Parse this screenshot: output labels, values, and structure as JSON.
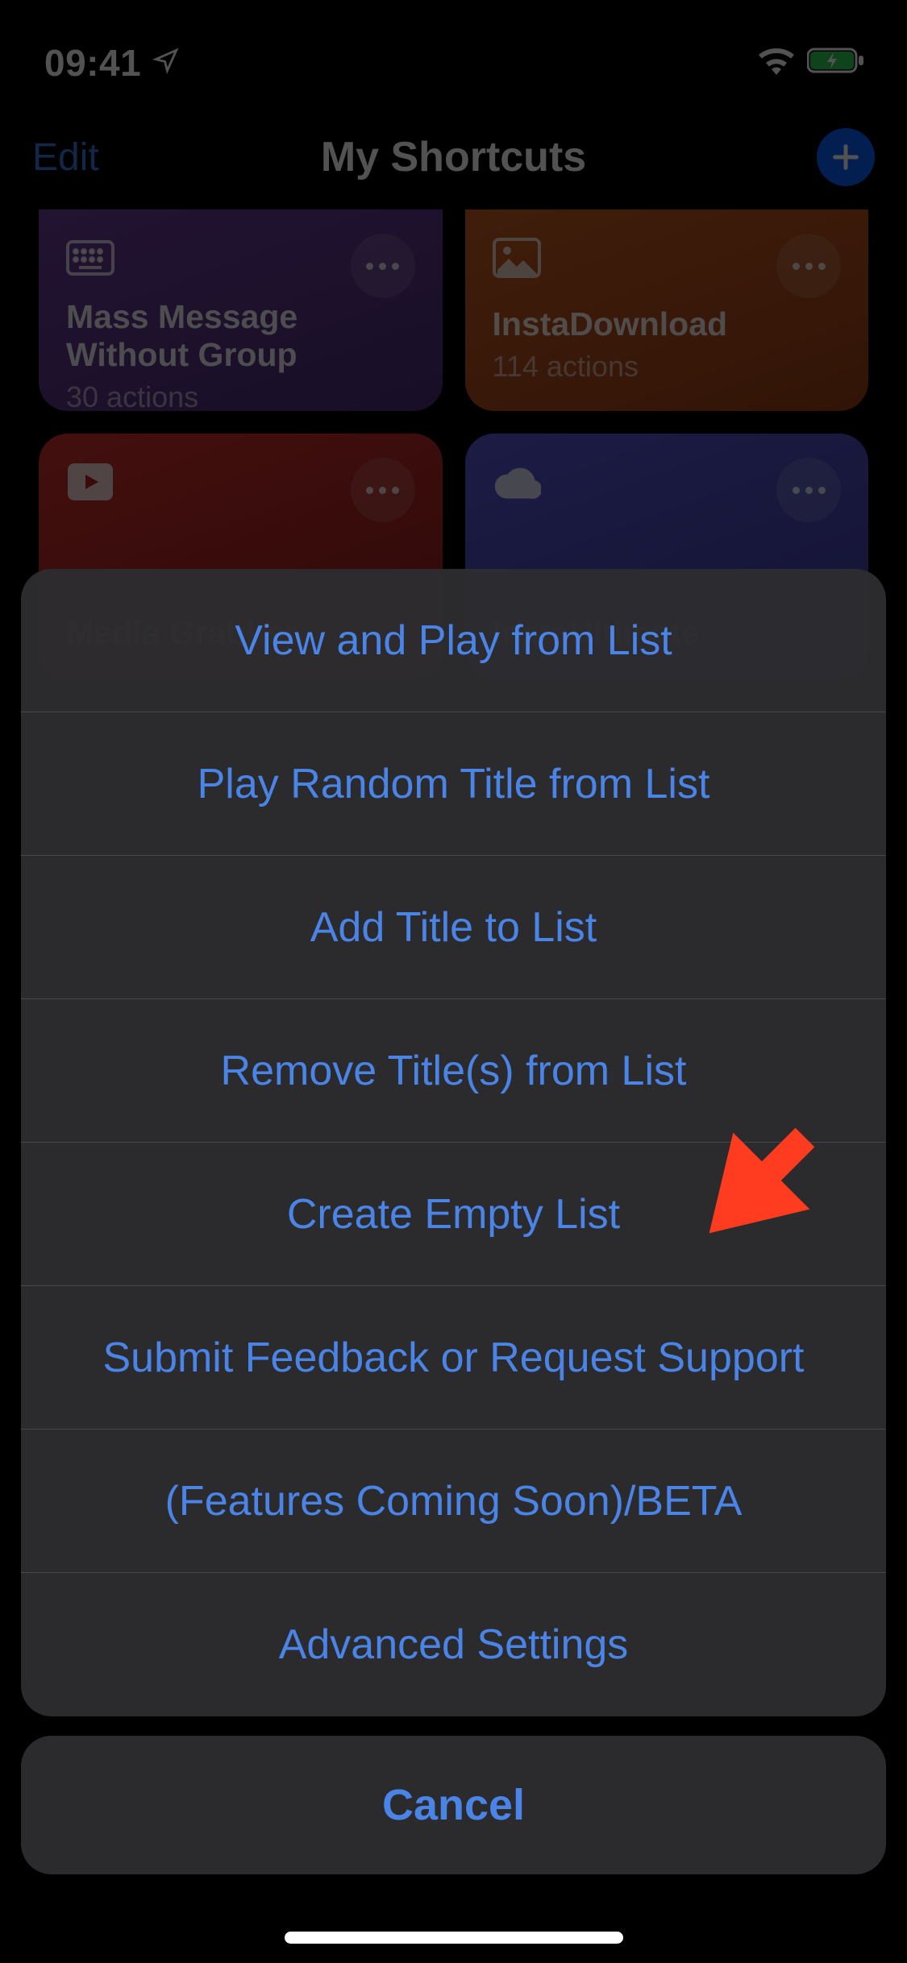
{
  "status": {
    "time": "09:41"
  },
  "nav": {
    "left": "Edit",
    "title": "My Shortcuts"
  },
  "cards": [
    {
      "title": "Mass Message Without Group",
      "subtitle": "30 actions",
      "icon": "keyboard"
    },
    {
      "title": "InstaDownload",
      "subtitle": "114 actions",
      "icon": "photo"
    },
    {
      "title": "Media Grabber",
      "subtitle": "",
      "icon": "play"
    },
    {
      "title": "InstaUltimate",
      "subtitle": "",
      "icon": "cloud"
    }
  ],
  "sheet": {
    "options": [
      "View and Play from List",
      "Play Random Title from List",
      "Add Title to List",
      "Remove Title(s) from List",
      "Create Empty List",
      "Submit Feedback or Request Support",
      "(Features Coming Soon)/BETA",
      "Advanced Settings"
    ],
    "cancel": "Cancel"
  }
}
